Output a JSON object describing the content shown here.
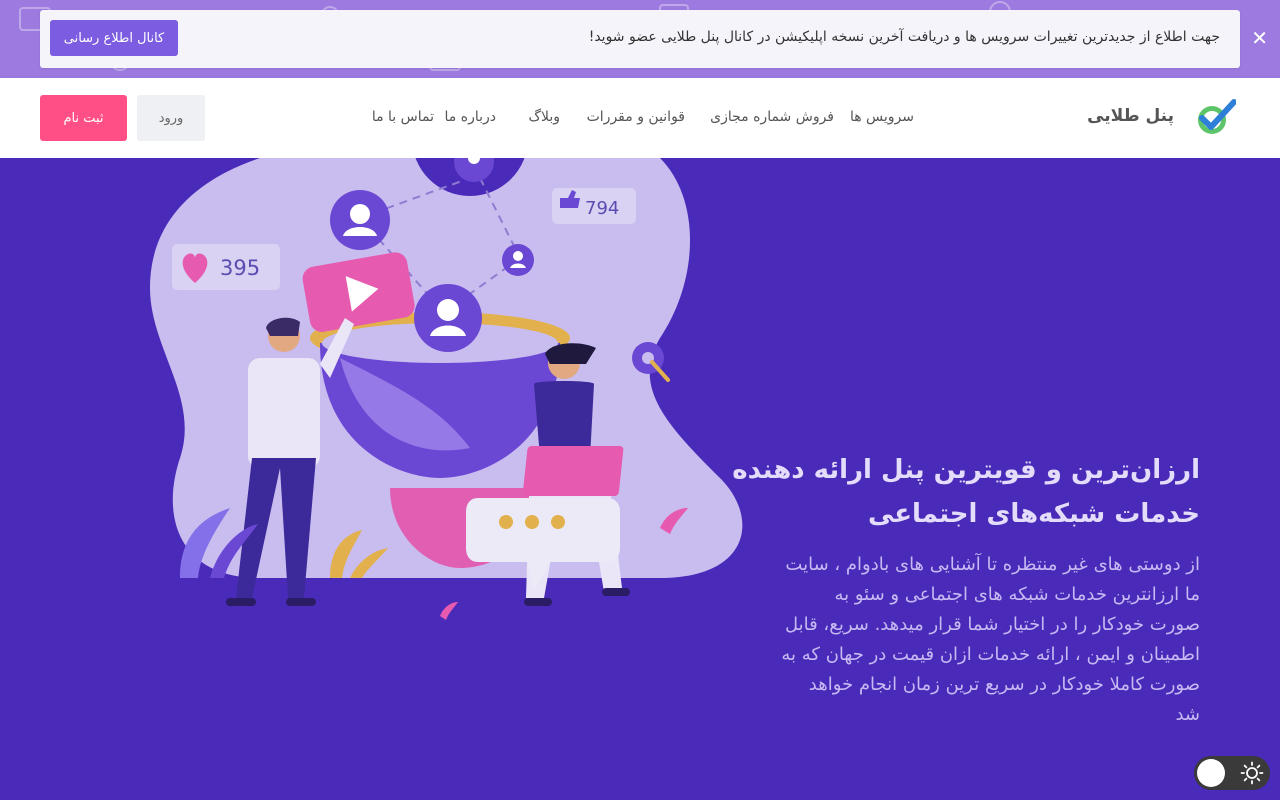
{
  "announcement": {
    "text": "جهت اطلاع از جدیدترین تغییرات سرویس ها و دریافت آخرین نسخه اپلیکیشن در کانال پنل طلایی عضو شوید!",
    "button_label": "کانال اطلاع رسانی",
    "close_symbol": "✕",
    "colors": {
      "strip": "#9d7ae0",
      "button": "#7c5ce0"
    }
  },
  "header": {
    "brand": "پنل طلایی",
    "logo_icon": "checkmark-logo-icon",
    "nav": [
      {
        "label": "سرویس ها"
      },
      {
        "label": "فروش شماره مجازی"
      },
      {
        "label": "قوانین و مقررات"
      },
      {
        "label": "وبلاگ"
      },
      {
        "label": "درباره ما"
      },
      {
        "label": "تماس با ما"
      }
    ],
    "login_label": "ورود",
    "register_label": "ثبت نام",
    "colors": {
      "register": "#ff4f86"
    }
  },
  "hero": {
    "title": "ارزان‌ترین و قویترین پنل ارائه دهنده خدمات شبکه‌های اجتماعی",
    "description": "از دوستی های غیر منتظره تا آشنایی های بادوام ، سایت ما ارزانترین خدمات شبکه های اجتماعی و سئو به صورت خودکار را در اختیار شما قرار میدهد. سریع، قابل اطمینان و ایمن ، ارائه خدمات ازان قیمت در جهان که به صورت کاملا خودکار در سریع ترین زمان انجام خواهد شد",
    "illustration": {
      "likes_count": "794",
      "hearts_count": "395"
    },
    "colors": {
      "background": "#4a2ab8"
    }
  },
  "theme_toggle": {
    "icon": "sun-icon"
  }
}
